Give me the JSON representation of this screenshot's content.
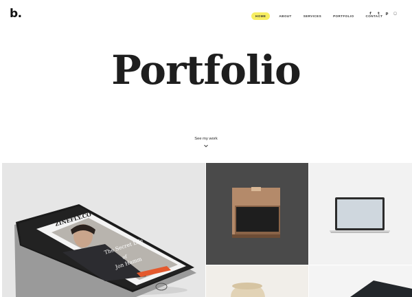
{
  "brand": {
    "logo": "b."
  },
  "nav": {
    "items": [
      {
        "label": "HOME",
        "active": true
      },
      {
        "label": "ABOUT",
        "active": false
      },
      {
        "label": "SERVICES",
        "active": false
      },
      {
        "label": "PORTFOLIO",
        "active": false
      },
      {
        "label": "CONTACT",
        "active": false
      }
    ],
    "active_color": "#f7ee62"
  },
  "social": [
    {
      "icon": "facebook-icon",
      "glyph": "f"
    },
    {
      "icon": "twitter-icon",
      "glyph": "t"
    },
    {
      "icon": "pinterest-icon",
      "glyph": "p"
    },
    {
      "icon": "instagram-icon",
      "glyph": "◻"
    }
  ],
  "hero": {
    "title": "Portfolio",
    "cta": "See my work",
    "cta_icon": "chevron-down-icon"
  },
  "portfolio": {
    "phone_mockup": {
      "brand": "ZINEFLY.CO",
      "headline_1": "The Secret Life",
      "headline_2": "of",
      "headline_3": "Jon Hamm"
    }
  }
}
